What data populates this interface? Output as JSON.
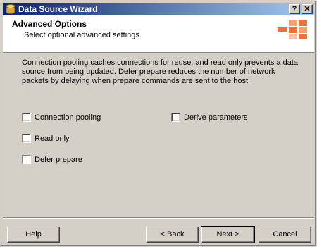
{
  "window": {
    "title": "Data Source Wizard",
    "help_caption": "?",
    "close_caption": "✕"
  },
  "header": {
    "title": "Advanced Options",
    "subtitle": "Select optional advanced settings."
  },
  "description": "Connection pooling caches connections for reuse, and read only prevents a data source from being updated. Defer prepare reduces the number of network packets by delaying when prepare commands are sent to the host.",
  "options": {
    "connection_pooling": {
      "label": "Connection pooling",
      "checked": false
    },
    "derive_parameters": {
      "label": "Derive parameters",
      "checked": false
    },
    "read_only": {
      "label": "Read only",
      "checked": false
    },
    "defer_prepare": {
      "label": "Defer prepare",
      "checked": false
    }
  },
  "buttons": {
    "help": "Help",
    "back": "< Back",
    "next": "Next >",
    "cancel": "Cancel"
  },
  "colors": {
    "titlebar_start": "#0a246a",
    "titlebar_end": "#a6caf0",
    "dialog_face": "#d4d0c8",
    "header_accent": "#e8743b"
  },
  "icons": {
    "title": "data-source-icon",
    "header": "wizard-graphic-icon"
  }
}
